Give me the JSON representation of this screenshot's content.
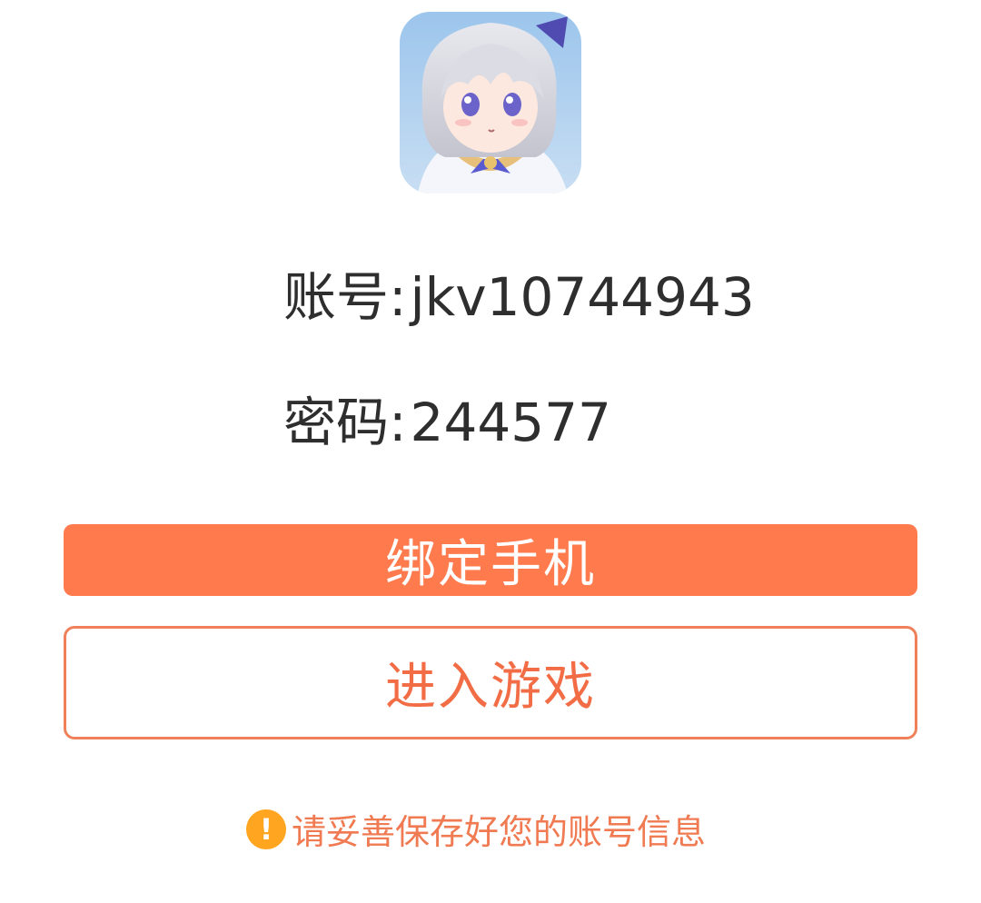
{
  "avatar": {
    "icon": "game-avatar-icon"
  },
  "account": {
    "label": "账号:",
    "value": "jkv10744943"
  },
  "password": {
    "label": "密码:",
    "value": "244577"
  },
  "buttons": {
    "bind_phone": "绑定手机",
    "enter_game": "进入游戏"
  },
  "tip": {
    "icon": "!",
    "text": "请妥善保存好您的账号信息"
  },
  "colors": {
    "primary": "#ff7a4d",
    "outline": "#f0805a",
    "warning": "#ffa51f",
    "text": "#2e2e2e"
  }
}
